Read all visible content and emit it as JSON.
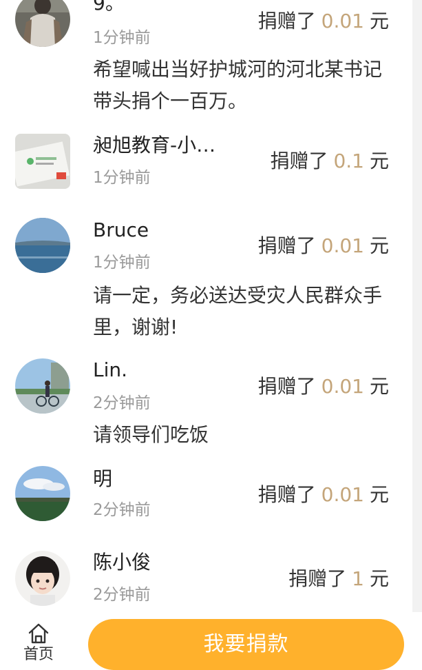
{
  "donations": [
    {
      "name": "9。",
      "time": "1分钟前",
      "action": "捐赠了",
      "amount": "0.01",
      "unit": "元",
      "message": "希望喊出当好护城河的河北某书记带头捐个一百万。",
      "avatar_icon": "man-back-photo-avatar"
    },
    {
      "name": "昶旭教育-小…",
      "time": "1分钟前",
      "action": "捐赠了",
      "amount": "0.1",
      "unit": "元",
      "message": "",
      "avatar_icon": "brand-logo-avatar"
    },
    {
      "name": "Bruce",
      "time": "1分钟前",
      "action": "捐赠了",
      "amount": "0.01",
      "unit": "元",
      "message": "请一定，务必送达受灾人民群众手里，谢谢!",
      "avatar_icon": "sea-photo-avatar"
    },
    {
      "name": "Lin.",
      "time": "2分钟前",
      "action": "捐赠了",
      "amount": "0.01",
      "unit": "元",
      "message": "请领导们吃饭",
      "avatar_icon": "bicycle-photo-avatar"
    },
    {
      "name": "明",
      "time": "2分钟前",
      "action": "捐赠了",
      "amount": "0.01",
      "unit": "元",
      "message": "",
      "avatar_icon": "landscape-photo-avatar"
    },
    {
      "name": "陈小俊",
      "time": "2分钟前",
      "action": "捐赠了",
      "amount": "1",
      "unit": "元",
      "message": "",
      "avatar_icon": "child-photo-avatar"
    }
  ],
  "bottom_bar": {
    "home_label": "首页",
    "home_icon": "home-icon",
    "donate_button_label": "我要捐款"
  },
  "colors": {
    "accent": "#ffb12c",
    "amount": "#c4a57a",
    "secondary_text": "#9a9a9a",
    "primary_text": "#222222"
  }
}
